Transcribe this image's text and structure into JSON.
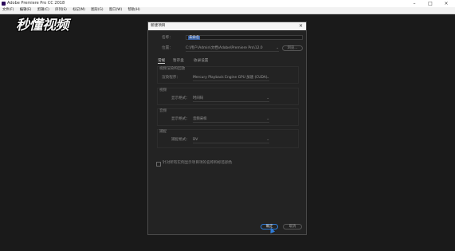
{
  "app": {
    "title": "Adobe Premiere Pro CC 2018",
    "watermark": "秒懂视频"
  },
  "menubar": {
    "items": [
      "文件(F)",
      "编辑(E)",
      "剪辑(C)",
      "序列(S)",
      "标记(M)",
      "图形(G)",
      "窗口(W)",
      "帮助(H)"
    ]
  },
  "dialog": {
    "title": "新建项目",
    "name_label": "名称：",
    "name_value": "未命名",
    "location_label": "位置：",
    "location_value": "C:\\用户\\Admin\\文档\\Adobe\\Premiere Pro\\12.0",
    "browse_label": "浏览...",
    "tabs": [
      "常规",
      "暂存盘",
      "收录设置"
    ],
    "renderer_section": "视频渲染和回放",
    "renderer_label": "渲染程序：",
    "renderer_value": "Mercury Playback Engine GPU 加速 (CUDA)",
    "video_section": "视频",
    "video_display_label": "显示格式：",
    "video_display_value": "时间码",
    "audio_section": "音频",
    "audio_display_label": "显示格式：",
    "audio_display_value": "音频采样",
    "capture_section": "捕捉",
    "capture_format_label": "捕捉格式：",
    "capture_format_value": "DV",
    "checkbox_label": "针对所有实例显示项目项的名称和标签颜色",
    "ok_label": "确定",
    "cancel_label": "取消"
  }
}
